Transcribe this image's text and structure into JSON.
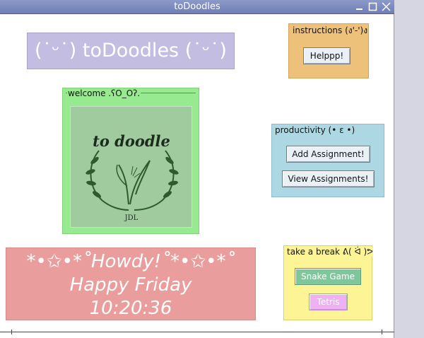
{
  "window": {
    "title": "toDoodles"
  },
  "header": {
    "text": "(˙ᵕ˙) toDoodles (˙ᵕ˙)"
  },
  "welcome": {
    "legend": "welcome .ʕO_Oʔ."
  },
  "logo": {
    "text": "to doodle",
    "initials": "JDL"
  },
  "instructions": {
    "legend": "instructions (ง'-')ง",
    "help_label": "Helppp!"
  },
  "productivity": {
    "legend": "productivity (• ε •)",
    "add_label": "Add Assignment!",
    "view_label": "View Assignments!"
  },
  "break_box": {
    "legend": "take a break ᕕ( ᐛ )ᕗ",
    "snake_label": "Snake Game",
    "tetris_label": "Tetris"
  },
  "clock": {
    "greeting": "*•✩•*˚Howdy!˚*•✩•*˚",
    "day": "Happy Friday",
    "time": "10:20:36"
  },
  "colors": {
    "header_bg": "#c3bde2",
    "welcome_bg": "#98ea90",
    "instructions_bg": "#eec17a",
    "productivity_bg": "#aed7e4",
    "break_bg": "#fdf496",
    "clock_bg": "#e99d9d",
    "snake_btn": "#7ec79a",
    "tetris_btn": "#efb1f2"
  },
  "icons": {
    "minimize": "minimize-icon",
    "maximize": "maximize-icon",
    "close": "close-icon"
  }
}
